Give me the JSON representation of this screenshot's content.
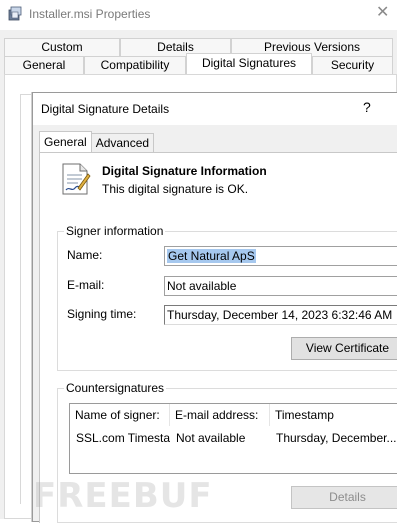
{
  "outer_window": {
    "title": "Installer.msi Properties",
    "close_glyph": "✕",
    "tabs_row1": [
      "Custom",
      "Details",
      "Previous Versions"
    ],
    "tabs_row2": [
      "General",
      "Compatibility",
      "Digital Signatures",
      "Security"
    ],
    "active_tab": "Digital Signatures"
  },
  "dialog": {
    "title": "Digital Signature Details",
    "help_glyph": "?",
    "tabs": [
      "General",
      "Advanced"
    ],
    "active_tab": "General",
    "info_heading": "Digital Signature Information",
    "info_text": "This digital signature is OK.",
    "signer_group": {
      "label": "Signer information",
      "name_label": "Name:",
      "name_value": "Get Natural ApS",
      "email_label": "E-mail:",
      "email_value": "Not available",
      "time_label": "Signing time:",
      "time_value": "Thursday, December 14, 2023 6:32:46 AM",
      "view_cert_button": "View Certificate"
    },
    "countersig_group": {
      "label": "Countersignatures",
      "columns": [
        "Name of signer:",
        "E-mail address:",
        "Timestamp"
      ],
      "rows": [
        [
          "SSL.com Timesta...",
          "Not available",
          "Thursday, December..."
        ]
      ],
      "details_button": "Details"
    }
  },
  "watermark": "FREEBUF",
  "colors": {
    "selection": "#a6c8ee",
    "window_bg": "#f0f0f0"
  }
}
